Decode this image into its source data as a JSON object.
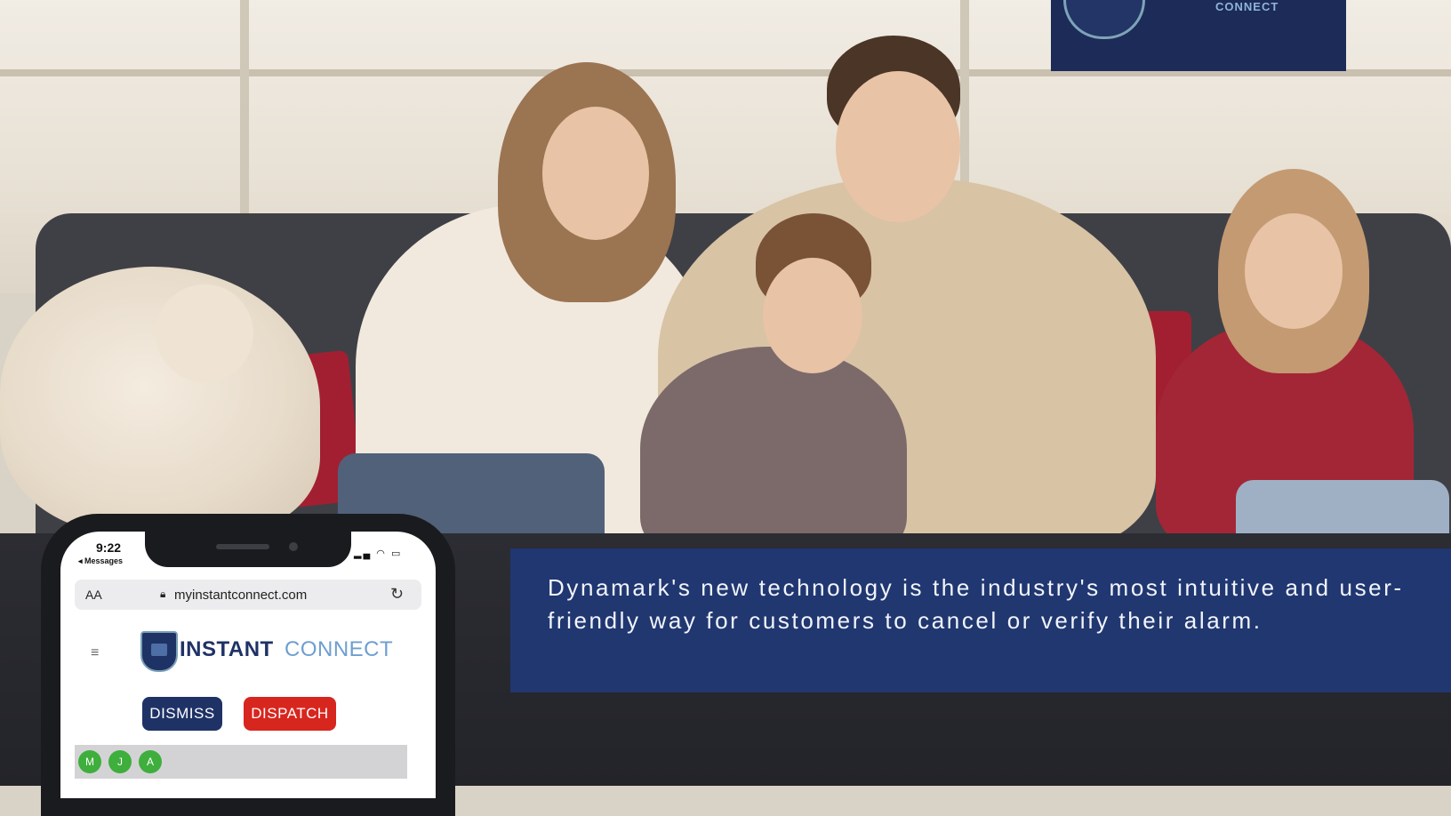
{
  "logo_badge": {
    "text": "CONNECT"
  },
  "caption": {
    "text": "Dynamark's new technology is the industry's most intuitive and user-friendly way for customers to cancel or verify their alarm."
  },
  "phone": {
    "status_bar": {
      "time": "9:22",
      "back_label": "◂ Messages",
      "icons": "▂▄ ◠ ▭"
    },
    "browser": {
      "text_size_label": "AA",
      "lock_icon": "lock-icon",
      "url": "myinstantconnect.com",
      "reload_icon": "↻"
    },
    "menu_icon": "≡",
    "brand": {
      "part1": "INSTANT",
      "part2": "CONNECT"
    },
    "buttons": {
      "dismiss": "DISMISS",
      "dispatch": "DISPATCH"
    },
    "participants": [
      "M",
      "J",
      "A"
    ]
  },
  "colors": {
    "navy": "#1f3266",
    "dispatch_red": "#d7261e",
    "participant_green": "#3eae3c",
    "caption_blue": "#203876"
  }
}
